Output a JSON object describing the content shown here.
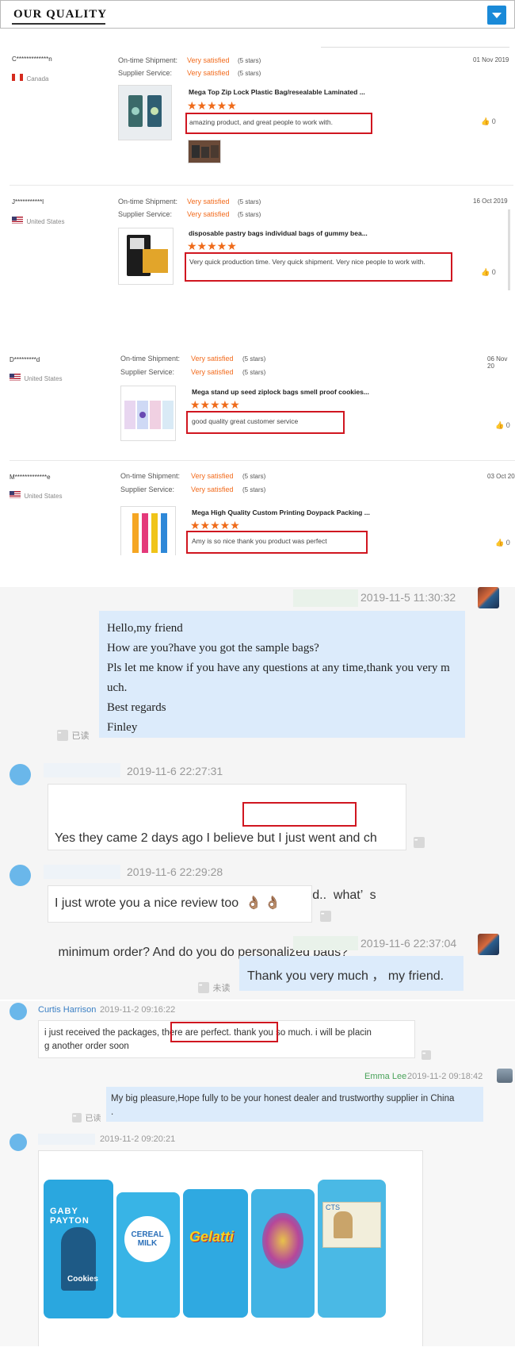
{
  "header": {
    "title": "OUR QUALITY"
  },
  "labels": {
    "shipment": "On-time Shipment:",
    "service": "Supplier Service:"
  },
  "reviews": [
    {
      "name": "C*************n",
      "country": "Canada",
      "flag": "ca",
      "shipment": "Very satisfied",
      "shipment_stars": "(5 stars)",
      "service": "Very satisfied",
      "service_stars": "(5 stars)",
      "date": "01 Nov 2019",
      "product": "Mega Top Zip Lock Plastic Bag/resealable Laminated ...",
      "stars": "★★★★★",
      "comment": "amazing product, and great people to work with.",
      "likes": "0"
    },
    {
      "name": "J***********l",
      "country": "United States",
      "flag": "us",
      "shipment": "Very satisfied",
      "shipment_stars": "(5 stars)",
      "service": "Very satisfied",
      "service_stars": "(5 stars)",
      "date": "16 Oct 2019",
      "product": "disposable pastry bags individual bags of gummy bea...",
      "stars": "★★★★★",
      "comment": "Very quick production time. Very quick shipment. Very nice people to work with.",
      "likes": "0"
    },
    {
      "name": "D*********d",
      "country": "United States",
      "flag": "us",
      "shipment": "Very satisfied",
      "shipment_stars": "(5 stars)",
      "service": "Very satisfied",
      "service_stars": "(5 stars)",
      "date": "06 Nov 20",
      "product": "Mega stand up seed ziplock bags smell proof cookies...",
      "stars": "★★★★★",
      "comment": "good quality great customer service",
      "likes": "0"
    },
    {
      "name": "M*************e",
      "country": "United States",
      "flag": "us",
      "shipment": "Very satisfied",
      "shipment_stars": "(5 stars)",
      "service": "Very satisfied",
      "service_stars": "(5 stars)",
      "date": "03 Oct 20",
      "product": "Mega High Quality Custom Printing Doypack Packing ...",
      "stars": "★★★★★",
      "comment": "Amy is so nice thank you product was perfect",
      "likes": "0"
    }
  ],
  "chat1": {
    "messages": [
      {
        "ts": "2019-11-5 11:30:32",
        "lines": [
          "Hello,my friend",
          "How are you?have you got the sample bags?",
          "Pls let me know if you have any questions at any time,thank you very m",
          "uch.",
          "Best regards",
          "Finley"
        ],
        "status": "已读"
      },
      {
        "ts": "2019-11-6 22:27:31",
        "lines": [
          "Yes they came 2 days ago I believe but I just went and ch",
          "ecked the address. Thanks bud, quality is good..  what’  s",
          " minimum order? And do you do personalized bags?"
        ]
      },
      {
        "ts": "2019-11-6 22:29:28",
        "text": "I just wrote you a nice review too",
        "emoji": "👌🏽 👌🏽"
      },
      {
        "ts": "2019-11-6 22:37:04",
        "text": "Thank you very much ， my friend.",
        "status": "未读"
      }
    ]
  },
  "chat2": {
    "messages": [
      {
        "name": "Curtis Harrison",
        "ts": "2019-11-2 09:16:22",
        "lines": [
          "i just received the packages, there are perfect. thank you so much. i will be placin",
          "g another order soon"
        ]
      },
      {
        "name": "Emma Lee",
        "ts": "2019-11-2 09:18:42",
        "lines": [
          "My big pleasure,Hope fully to be your honest dealer and trustworthy supplier in China",
          "."
        ],
        "status": "已读"
      },
      {
        "ts": "2019-11-2 09:20:21"
      }
    ],
    "bags": [
      {
        "label": "GABY PAYTON",
        "sub": "Cookies",
        "color": "#2aa7df"
      },
      {
        "label": "CEREAL MILK",
        "sub": "",
        "color": "#38b4e6"
      },
      {
        "label": "Gelatti",
        "sub": "",
        "color": "#2fa9e1"
      },
      {
        "label": "",
        "sub": "",
        "color": "#41b3e4"
      },
      {
        "label": "CTS",
        "sub": "",
        "color": "#4ab9e5"
      }
    ]
  }
}
